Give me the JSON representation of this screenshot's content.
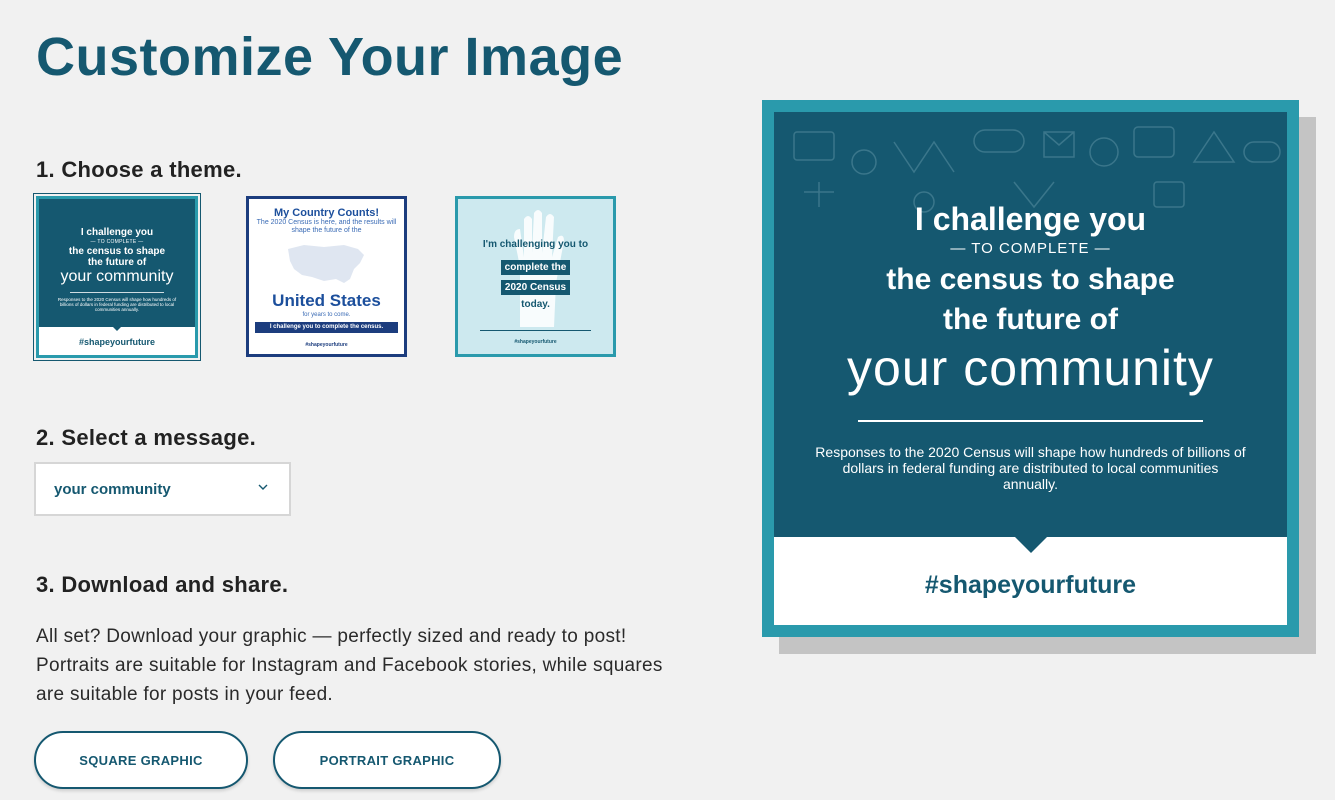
{
  "page": {
    "title": "Customize Your Image"
  },
  "steps": {
    "step1": "1. Choose a theme.",
    "step2": "2. Select a message.",
    "step3": "3. Download and share."
  },
  "themes": [
    {
      "name": "teal-community",
      "line1": "I challenge you",
      "line2": "— TO COMPLETE —",
      "line3": "the census to shape",
      "line4": "the future of",
      "line5": "your community",
      "small": "Responses to the 2020 Census will shape how hundreds of billions of dollars in federal funding are distributed to local communities annually.",
      "hashtag": "#shapeyourfuture",
      "selected": true
    },
    {
      "name": "my-country-counts",
      "title": "My Country Counts!",
      "sub": "The 2020 Census is here, and the results will shape the future of the",
      "big": "United States",
      "years": "for years to come.",
      "bar": "I challenge you to complete the census.",
      "hashtag": "#shapeyourfuture",
      "selected": false
    },
    {
      "name": "hand-raised",
      "line1": "I'm challenging you to",
      "box1": "complete the",
      "box2": "2020 Census",
      "today": "today.",
      "hashtag": "#shapeyourfuture",
      "selected": false
    }
  ],
  "message_select": {
    "value": "your community"
  },
  "download": {
    "description": "All set? Download your graphic — perfectly sized and ready to post! Portraits are suitable for Instagram and Facebook stories, while squares are suitable for posts in your feed.",
    "square_label": "SQUARE GRAPHIC",
    "portrait_label": "PORTRAIT GRAPHIC"
  },
  "preview": {
    "line1": "I challenge you",
    "line2": "— TO COMPLETE —",
    "line3a": "the census to shape",
    "line3b": "the future of",
    "line4": "your community",
    "small": "Responses to the 2020 Census will shape how hundreds of billions of dollars in federal funding are distributed to local communities annually.",
    "hashtag": "#shapeyourfuture"
  },
  "colors": {
    "brand": "#155870",
    "accent": "#2a9aac",
    "background": "#f1f1f1"
  }
}
